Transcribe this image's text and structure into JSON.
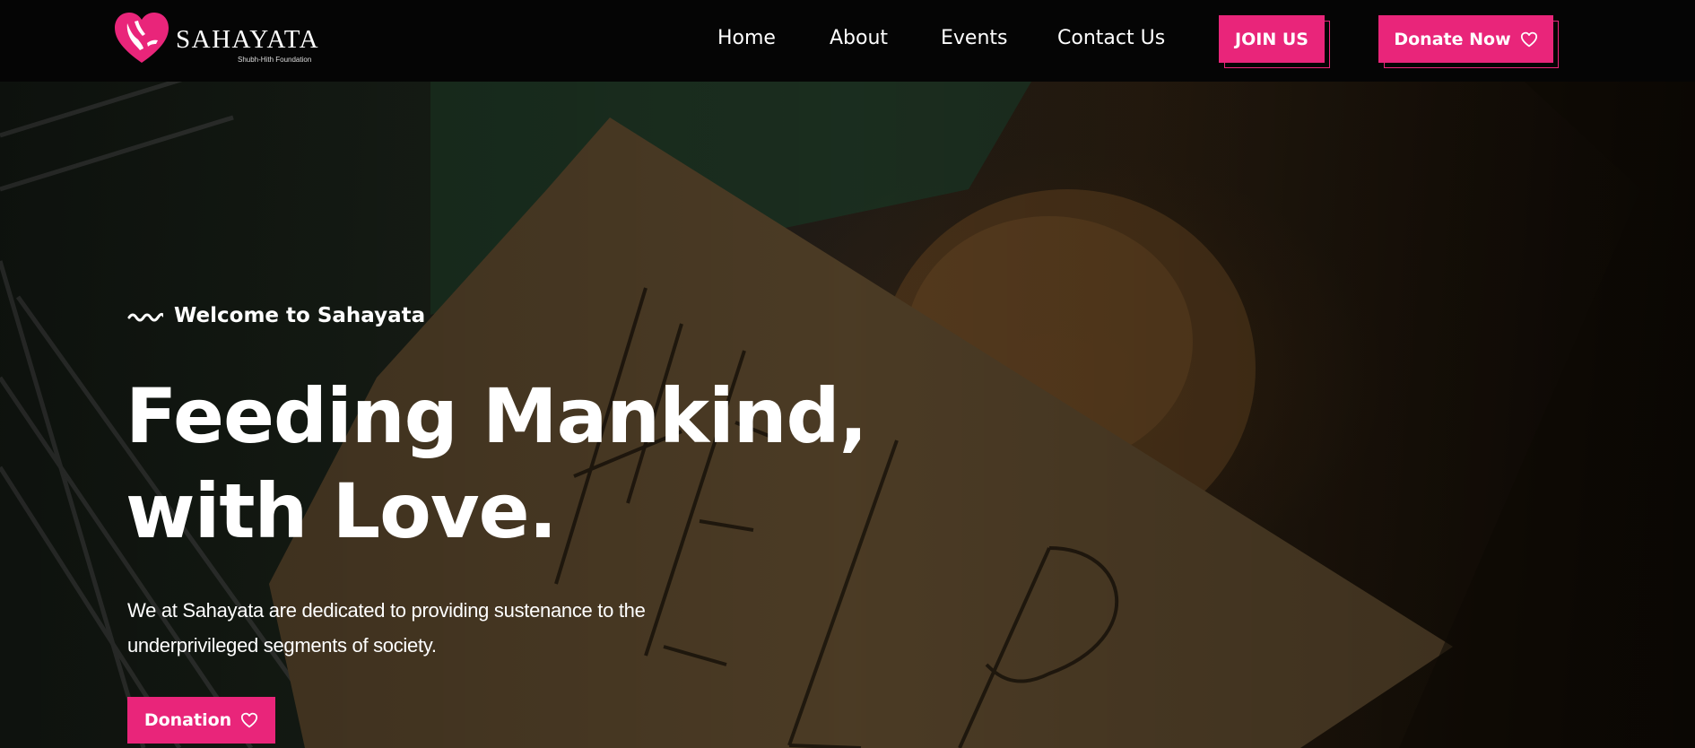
{
  "brand": {
    "name": "SAHAYATA",
    "tagline": "Shubh-Hith Foundation",
    "icon": "heart-hands-logo",
    "accent_color": "#e9257a"
  },
  "nav": {
    "items": [
      {
        "label": "Home"
      },
      {
        "label": "About"
      },
      {
        "label": "Events"
      },
      {
        "label": "Contact Us"
      }
    ],
    "join_label": "JOIN US",
    "donate_label": "Donate Now",
    "donate_icon": "heart-outline-icon"
  },
  "hero": {
    "eyebrow": "Welcome to Sahayata",
    "eyebrow_icon": "wave-icon",
    "headline_line1": "Feeding Mankind,",
    "headline_line2": "with Love.",
    "description": "We at Sahayata are dedicated to providing sustenance to the underprivileged segments of society.",
    "cta_label": "Donation",
    "cta_icon": "heart-outline-icon",
    "background": "cardboard HELP sign photo"
  }
}
